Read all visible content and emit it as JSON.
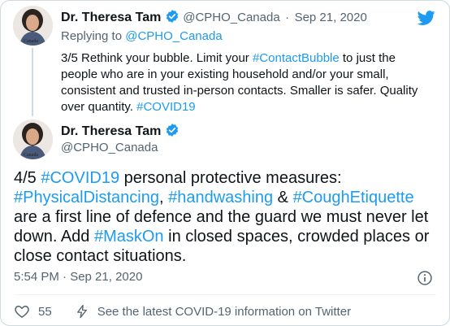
{
  "parent": {
    "name": "Dr. Theresa Tam",
    "handle": "@CPHO_Canada",
    "separator": "·",
    "date": "Sep 21, 2020",
    "replying_prefix": "Replying to ",
    "replying_to": "@CPHO_Canada",
    "text_parts": {
      "t1": "3/5 Rethink your bubble. Limit your ",
      "h1": "#ContactBubble",
      "t2": " to just the people who are in your existing household and/or your small, consistent and trusted in-person contacts. Smaller is safer. Quality over quantity. ",
      "h2": "#COVID19"
    }
  },
  "main": {
    "name": "Dr. Theresa Tam",
    "handle": "@CPHO_Canada",
    "text_parts": {
      "t1": "4/5 ",
      "h1": "#COVID19",
      "t2": " personal protective measures: ",
      "h2": "#PhysicalDistancing",
      "t3": ", ",
      "h3": "#handwashing",
      "t4": " & ",
      "h4": "#CoughEtiquette",
      "t5": " are a first line of defence and the guard we must never let down. Add ",
      "h5": "#MaskOn",
      "t6": " in closed spaces, crowded places or close contact situations."
    },
    "timestamp": "5:54 PM · Sep 21, 2020"
  },
  "actions": {
    "like_count": "55",
    "info_label": "See the latest COVID-19 information on Twitter"
  },
  "avatar_caption": "Canada",
  "colors": {
    "link": "#1d9bf0",
    "text": "#0f1419",
    "muted": "#536471",
    "verified": "#1d9bf0",
    "twitter": "#1d9bf0"
  },
  "icons": [
    "twitter-bird-icon",
    "verified-badge-icon",
    "info-icon",
    "heart-icon",
    "lightning-icon"
  ]
}
